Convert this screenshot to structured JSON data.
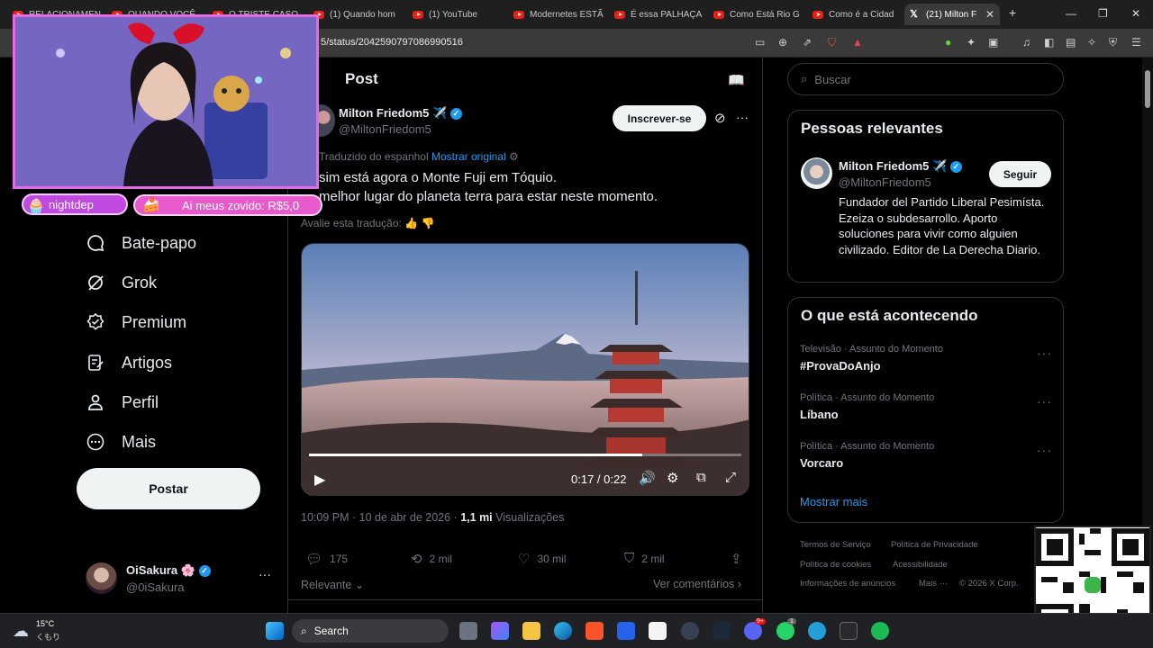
{
  "browser": {
    "tabs": [
      {
        "label": "RELACIONAMEN"
      },
      {
        "label": "QUANDO VOCÊ"
      },
      {
        "label": "O TRISTE CASO"
      },
      {
        "label": "(1) Quando hom"
      },
      {
        "label": "(1) YouTube"
      },
      {
        "label": "Modernetes ESTÃ"
      },
      {
        "label": "É essa PALHAÇA"
      },
      {
        "label": "Como Está Rio G"
      },
      {
        "label": "Como é a Cidad"
      },
      {
        "label": "(21) Milton F"
      }
    ],
    "url": "5/status/2042590797086990516",
    "new_tab": "+",
    "close": "✕"
  },
  "nav": {
    "items": [
      {
        "label": "Bate-papo",
        "icon": "chat-icon"
      },
      {
        "label": "Grok",
        "icon": "grok-icon"
      },
      {
        "label": "Premium",
        "icon": "premium-icon"
      },
      {
        "label": "Artigos",
        "icon": "articles-icon"
      },
      {
        "label": "Perfil",
        "icon": "profile-icon"
      },
      {
        "label": "Mais",
        "icon": "more-icon"
      }
    ],
    "post_button": "Postar",
    "account": {
      "name": "OiSakura 🌸",
      "handle": "@0iSakura"
    }
  },
  "post": {
    "header": "Post",
    "author_name": "Milton Friedom5 ✈️",
    "author_handle": "@MiltonFriedom5",
    "subscribe": "Inscrever-se",
    "translated_from": "Traduzido do espanhol",
    "show_original": "Mostrar original",
    "text_line1": "sim está agora o Monte Fuji em Tóquio.",
    "text_line2": "melhor lugar do planeta terra para estar neste momento.",
    "rate_translation": "Avalie esta tradução:",
    "video_time": "0:17 / 0:22",
    "video_progress": 0.77,
    "timestamp": "10:09 PM · 10 de abr de 2026 ·",
    "views_count": "1,1 mi",
    "views_label": "Visualizações",
    "replies": "175",
    "reposts": "2 mil",
    "likes": "30 mil",
    "bookmarks": "2 mil",
    "sort_label": "Relevante",
    "see_comments": "Ver comentários"
  },
  "sidebar": {
    "search_placeholder": "Buscar",
    "relevant_title": "Pessoas relevantes",
    "person_name": "Milton Friedom5 ✈️",
    "person_handle": "@MiltonFriedom5",
    "follow": "Seguir",
    "person_bio": "Fundador del Partido Liberal Pesimísta. Ezeiza o subdesarrollo. Aporto soluciones para vivir como alguien civilizado. Editor de La Derecha Diario.",
    "trends_title": "O que está acontecendo",
    "trends": [
      {
        "category": "Televisão · Assunto do Momento",
        "name": "#ProvaDoAnjo"
      },
      {
        "category": "Política · Assunto do Momento",
        "name": "Líbano"
      },
      {
        "category": "Política · Assunto do Momento",
        "name": "Vorcaro"
      }
    ],
    "show_more": "Mostrar mais",
    "footer": [
      "Termos de Serviço",
      "Política de Privacidade",
      "Política de cookies",
      "Acessibilidade",
      "Informações de anúncios",
      "Mais ···",
      "© 2026 X Corp."
    ]
  },
  "overlay": {
    "chat_user": "nightdep",
    "donation": "Ai meus zovido: R$5,0"
  },
  "taskbar": {
    "weather_temp": "15°C",
    "weather_desc": "くもり",
    "search": "Search",
    "badge_discord": "9+",
    "badge_whatsapp": "1"
  },
  "colors": {
    "accent": "#1d9bf0",
    "pink": "#e46be4",
    "background": "#000000"
  }
}
